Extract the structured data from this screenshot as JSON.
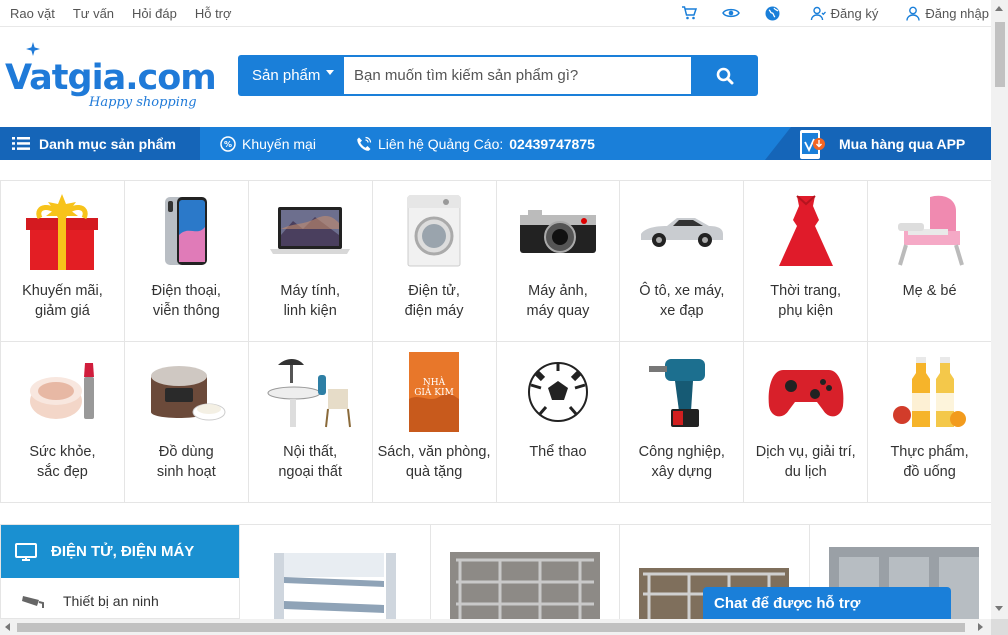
{
  "topbar": {
    "links": [
      "Rao vặt",
      "Tư vấn",
      "Hỏi đáp",
      "Hỗ trợ"
    ],
    "icons": [
      "cart-icon",
      "eye-icon",
      "globe-icon"
    ],
    "register_label": "Đăng ký",
    "login_label": "Đăng nhập"
  },
  "header": {
    "logo_text": "Vatgia.com",
    "logo_slogan": "Happy shopping",
    "search_category": "Sản phẩm",
    "search_placeholder": "Bạn muốn tìm kiếm sản phẩm gì?"
  },
  "navbar": {
    "categories_label": "Danh mục sản phẩm",
    "promo_label": "Khuyến mại",
    "contact_label": "Liên hệ Quảng Cáo:",
    "contact_phone": "02439747875",
    "app_label": "Mua hàng qua APP"
  },
  "categories": [
    {
      "label": "Khuyến mãi,\ngiảm giá",
      "icon": "gift-box"
    },
    {
      "label": "Điện thoại,\nviễn thông",
      "icon": "smartphone"
    },
    {
      "label": "Máy tính,\nlinh kiện",
      "icon": "laptop"
    },
    {
      "label": "Điện tử,\nđiện máy",
      "icon": "washing-machine"
    },
    {
      "label": "Máy ảnh,\nmáy quay",
      "icon": "camera"
    },
    {
      "label": "Ô tô, xe máy,\nxe đạp",
      "icon": "car"
    },
    {
      "label": "Thời trang,\nphụ kiện",
      "icon": "dress"
    },
    {
      "label": "Mẹ & bé",
      "icon": "baby-chair"
    },
    {
      "label": "Sức khỏe,\nsắc đẹp",
      "icon": "cosmetics"
    },
    {
      "label": "Đồ dùng\nsinh hoạt",
      "icon": "rice-cooker"
    },
    {
      "label": "Nội thất,\nngoại thất",
      "icon": "furniture"
    },
    {
      "label": "Sách, văn phòng,\nquà tặng",
      "icon": "book"
    },
    {
      "label": "Thể thao",
      "icon": "soccer-ball"
    },
    {
      "label": "Công nghiệp,\nxây dựng",
      "icon": "drill"
    },
    {
      "label": "Dịch vụ, giải trí,\ndu lịch",
      "icon": "gamepad"
    },
    {
      "label": "Thực phẩm,\nđồ uống",
      "icon": "juice-bottles"
    }
  ],
  "section": {
    "title": "ĐIỆN TỬ, ĐIỆN MÁY",
    "first_item": "Thiết bị an ninh"
  },
  "chat": {
    "label": "Chat để được hỗ trợ"
  },
  "colors": {
    "primary": "#1a7fd9",
    "dark": "#1565b8",
    "section": "#1a90d1"
  }
}
